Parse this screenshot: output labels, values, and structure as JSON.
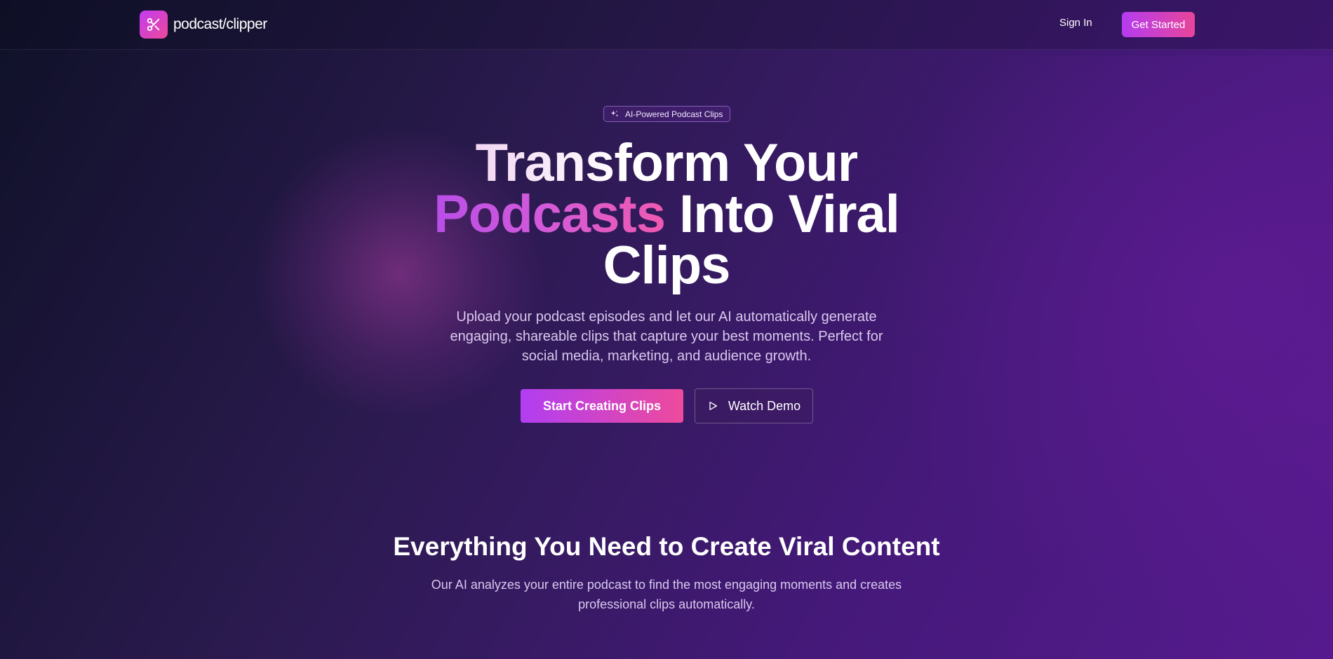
{
  "header": {
    "brand": "podcast/clipper",
    "logo_icon": "scissors-icon",
    "sign_in_label": "Sign In",
    "get_started_label": "Get Started"
  },
  "hero": {
    "badge_icon": "sparkles-icon",
    "badge_text": "AI-Powered Podcast Clips",
    "headline_line1": "Transform Your",
    "headline_accent": "Podcasts",
    "headline_line2_rest": " Into Viral",
    "headline_line3": "Clips",
    "description": "Upload your podcast episodes and let our AI automatically generate engaging, shareable clips that capture your best moments. Perfect for social media, marketing, and audience growth.",
    "primary_cta": "Start Creating Clips",
    "secondary_cta": "Watch Demo",
    "secondary_cta_icon": "play-icon"
  },
  "features": {
    "title": "Everything You Need to Create Viral Content",
    "subtitle": "Our AI analyzes your entire podcast to find the most engaging moments and creates professional clips automatically."
  },
  "colors": {
    "accent_start": "#b13ef2",
    "accent_end": "#ee4a9c",
    "background_dark": "#0f1128",
    "background_purple": "#561a8e"
  }
}
